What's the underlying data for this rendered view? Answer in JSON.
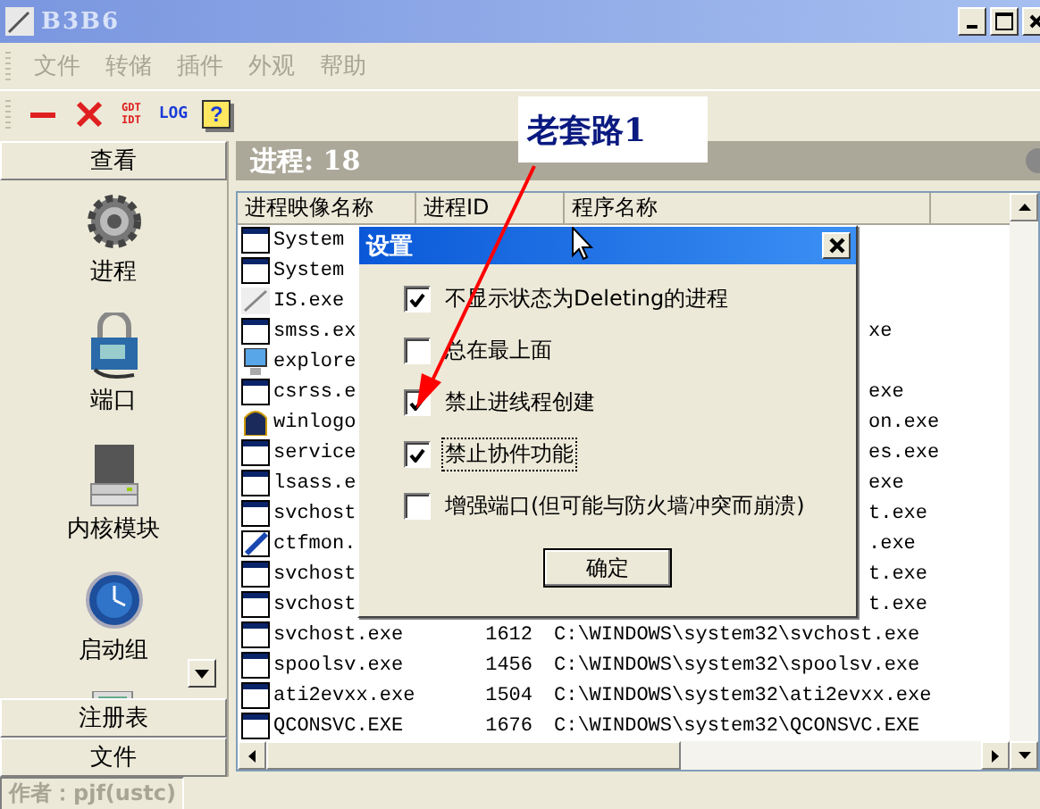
{
  "window": {
    "title": "B3B6"
  },
  "menu": [
    "文件",
    "转储",
    "插件",
    "外观",
    "帮助"
  ],
  "toolbar": [
    {
      "kind": "minus"
    },
    {
      "kind": "cross"
    },
    {
      "kind": "tables",
      "lines": [
        "GDT",
        "IDT"
      ]
    },
    {
      "kind": "log",
      "label": "LOG"
    },
    {
      "kind": "help",
      "label": "?"
    }
  ],
  "sidebar": {
    "header": "查看",
    "items": [
      {
        "label": "进程",
        "kind": "gear"
      },
      {
        "label": "端口",
        "kind": "lock"
      },
      {
        "label": "内核模块",
        "kind": "drive"
      },
      {
        "label": "启动组",
        "kind": "clock"
      },
      {
        "kind": "computer"
      }
    ],
    "footer": [
      "注册表",
      "文件"
    ]
  },
  "process_panel": {
    "title": "进程: 18",
    "columns": [
      "进程映像名称",
      "进程ID",
      "程序名称"
    ],
    "rows": [
      {
        "kind": "window",
        "name": "System"
      },
      {
        "kind": "window",
        "name": "System"
      },
      {
        "kind": "pen",
        "name": "IS.exe"
      },
      {
        "kind": "window",
        "name": "smss.ex",
        "tail": "xe"
      },
      {
        "kind": "monitor",
        "name": "explore"
      },
      {
        "kind": "window",
        "name": "csrss.e",
        "tail": "exe"
      },
      {
        "kind": "shield",
        "name": "winlogo",
        "tail": "on.exe"
      },
      {
        "kind": "window",
        "name": "service",
        "tail": "es.exe"
      },
      {
        "kind": "window",
        "name": "lsass.e",
        "tail": "exe"
      },
      {
        "kind": "window",
        "name": "svchost",
        "tail": "t.exe"
      },
      {
        "kind": "notepad",
        "name": "ctfmon.",
        "tail": ".exe"
      },
      {
        "kind": "window",
        "name": "svchost",
        "tail": "t.exe"
      },
      {
        "kind": "window",
        "name": "svchost",
        "tail": "t.exe"
      },
      {
        "kind": "window",
        "name": "svchost.exe",
        "pid": "1612",
        "path": "C:\\WINDOWS\\system32\\svchost.exe"
      },
      {
        "kind": "window",
        "name": "spoolsv.exe",
        "pid": "1456",
        "path": "C:\\WINDOWS\\system32\\spoolsv.exe"
      },
      {
        "kind": "window",
        "name": "ati2evxx.exe",
        "pid": "1504",
        "path": "C:\\WINDOWS\\system32\\ati2evxx.exe"
      },
      {
        "kind": "window",
        "name": "QCONSVC.EXE",
        "pid": "1676",
        "path": "C:\\WINDOWS\\system32\\QCONSVC.EXE"
      }
    ]
  },
  "dialog": {
    "title": "设置",
    "options": [
      {
        "label": "不显示状态为Deleting的进程",
        "checked": true,
        "focused": false
      },
      {
        "label": "总在最上面",
        "checked": false,
        "focused": false
      },
      {
        "label": "禁止进线程创建",
        "checked": true,
        "focused": false
      },
      {
        "label": "禁止协件功能",
        "checked": true,
        "focused": true
      },
      {
        "label": "增强端口(但可能与防火墙冲突而崩溃)",
        "checked": false,
        "focused": false
      }
    ],
    "button": "确定"
  },
  "annotation": {
    "label": "老套路1"
  },
  "status_bar": "作者：pjf(ustc)"
}
